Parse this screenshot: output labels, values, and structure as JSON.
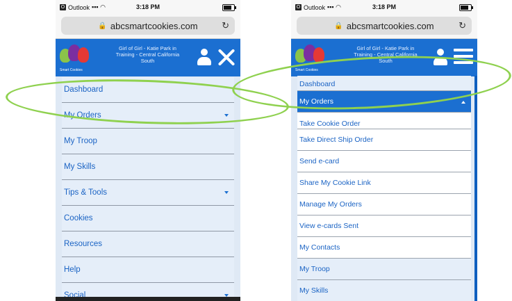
{
  "status_bar": {
    "carrier_icon": "O",
    "carrier": "Outlook",
    "time": "3:18 PM"
  },
  "browser": {
    "url": "abcsmartcookies.com"
  },
  "header": {
    "logo_text": "Smart Cookies",
    "troop_line1": "Girl of Girl - Katie Park in",
    "troop_line2": "Training - Central California",
    "troop_line3": "South"
  },
  "left_menu": {
    "items": [
      {
        "label": "Dashboard",
        "has_caret": false
      },
      {
        "label": "My Orders",
        "has_caret": true
      },
      {
        "label": "My Troop",
        "has_caret": false
      },
      {
        "label": "My Skills",
        "has_caret": false
      },
      {
        "label": "Tips & Tools",
        "has_caret": true
      },
      {
        "label": "Cookies",
        "has_caret": false
      },
      {
        "label": "Resources",
        "has_caret": false
      },
      {
        "label": "Help",
        "has_caret": false
      },
      {
        "label": "Social",
        "has_caret": true
      }
    ]
  },
  "right_menu": {
    "top": "Dashboard",
    "active": "My Orders",
    "sub_cut": "Take Cookie Order",
    "subitems": [
      "Take Direct Ship Order",
      "Send e-card",
      "Share My Cookie Link",
      "Manage My Orders",
      "View e-cards Sent",
      "My Contacts"
    ],
    "after": [
      "My Troop",
      "My Skills"
    ]
  },
  "annotation_color": "#8fd14f",
  "accent_color": "#1b6fd1"
}
